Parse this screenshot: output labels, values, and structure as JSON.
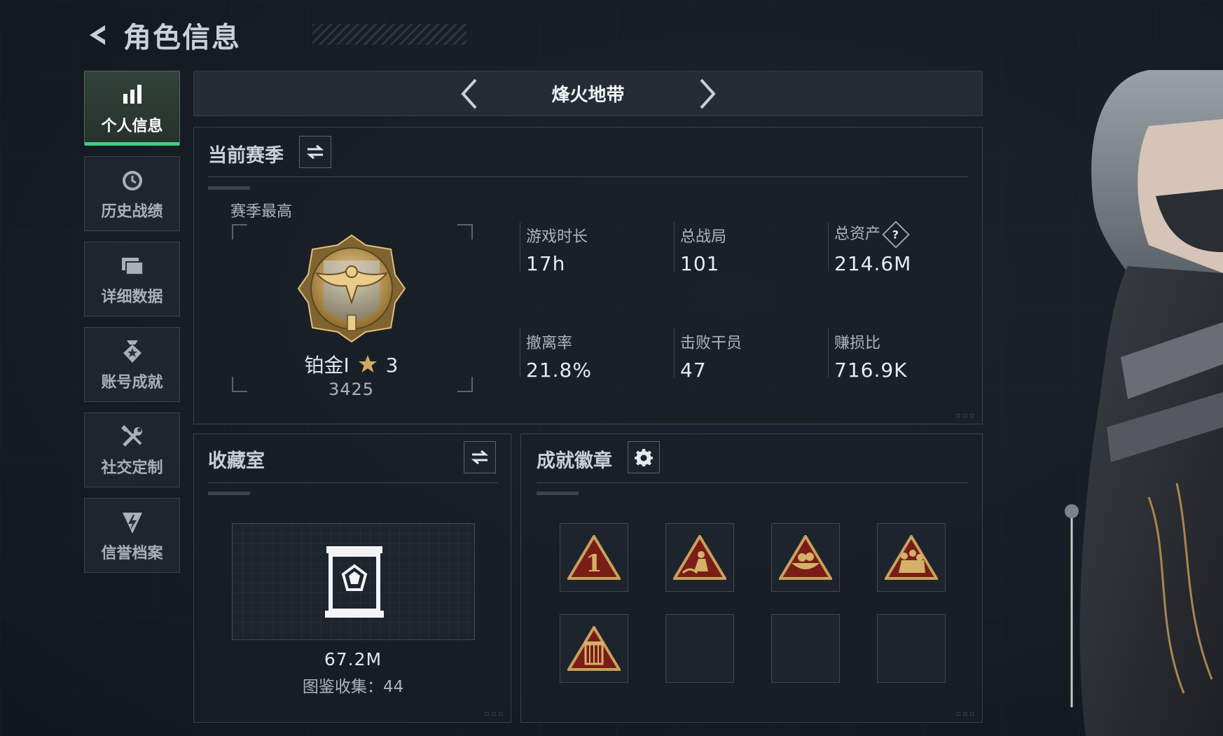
{
  "header": {
    "title": "角色信息"
  },
  "sidebar": {
    "items": [
      {
        "label": "个人信息",
        "icon": "bar-chart-icon",
        "active": true
      },
      {
        "label": "历史战绩",
        "icon": "clock-history-icon",
        "active": false
      },
      {
        "label": "详细数据",
        "icon": "folder-icon",
        "active": false
      },
      {
        "label": "账号成就",
        "icon": "medal-star-icon",
        "active": false
      },
      {
        "label": "社交定制",
        "icon": "wrench-screwdriver-icon",
        "active": false
      },
      {
        "label": "信誉档案",
        "icon": "shield-bolt-icon",
        "active": false
      }
    ]
  },
  "mode": {
    "name": "烽火地带"
  },
  "season": {
    "title": "当前赛季",
    "best_label": "赛季最高",
    "rank_name": "铂金Ⅰ",
    "rank_stars": "3",
    "rank_score": "3425",
    "stats": [
      {
        "label": "游戏时长",
        "value": "17h"
      },
      {
        "label": "总战局",
        "value": "101"
      },
      {
        "label": "总资产",
        "value": "214.6M",
        "help": "?"
      },
      {
        "label": "撤离率",
        "value": "21.8%"
      },
      {
        "label": "击败干员",
        "value": "47"
      },
      {
        "label": "赚损比",
        "value": "716.9K"
      }
    ]
  },
  "collection": {
    "title": "收藏室",
    "value": "67.2M",
    "catalog_label": "图鉴收集：",
    "catalog_count": "44"
  },
  "achievements": {
    "title": "成就徽章",
    "badges": [
      {
        "icon": "badge-number-one-icon",
        "text": "1",
        "filled": true
      },
      {
        "icon": "badge-worker-icon",
        "filled": true
      },
      {
        "icon": "badge-boat-icon",
        "filled": true
      },
      {
        "icon": "badge-squad-icon",
        "filled": true
      },
      {
        "icon": "badge-cage-icon",
        "filled": true
      },
      {
        "icon": "empty-slot",
        "filled": false
      },
      {
        "icon": "empty-slot",
        "filled": false
      },
      {
        "icon": "empty-slot",
        "filled": false
      }
    ]
  },
  "colors": {
    "accent_green": "#3fcf85",
    "badge_red": "#7a1d16",
    "badge_gold": "#c8a25a",
    "rank_gold": "#d2aa62"
  }
}
